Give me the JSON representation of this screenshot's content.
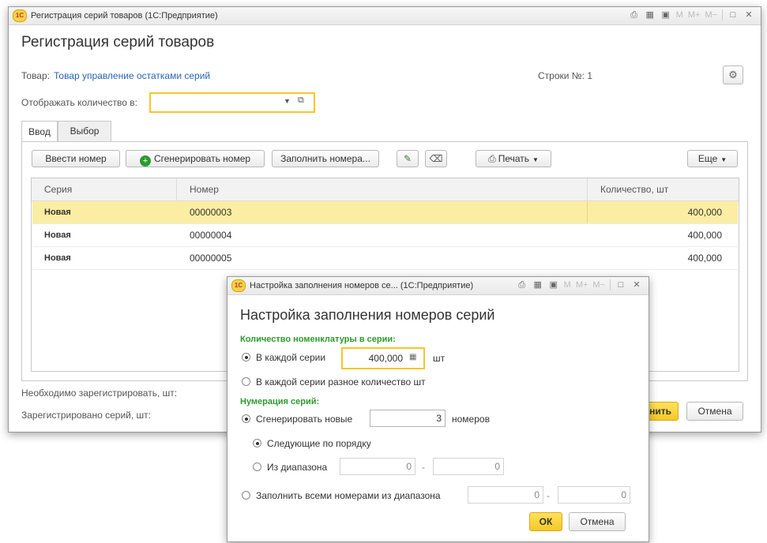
{
  "main": {
    "window_title": "Регистрация серий товаров  (1С:Предприятие)",
    "title": "Регистрация серий товаров",
    "product_label": "Товар:",
    "product_link": "Товар управление остатками серий",
    "rows_label": "Строки №: 1",
    "display_label": "Отображать количество в:",
    "display_value": "",
    "tabs": [
      "Ввод",
      "Выбор"
    ],
    "toolbar": {
      "enter_number": "Ввести номер",
      "generate_number": "Сгенерировать номер",
      "fill_numbers": "Заполнить номера...",
      "print": "Печать",
      "more": "Еще"
    },
    "table": {
      "columns": [
        "Серия",
        "Номер",
        "Количество, шт"
      ],
      "rows": [
        {
          "series": "Новая",
          "number": "00000003",
          "qty": "400,000"
        },
        {
          "series": "Новая",
          "number": "00000004",
          "qty": "400,000"
        },
        {
          "series": "Новая",
          "number": "00000005",
          "qty": "400,000"
        }
      ]
    },
    "need_register_label": "Необходимо зарегистрировать, шт:",
    "registered_label": "Зарегистрировано серий, шт:",
    "register_button": "нить",
    "cancel_button": "Отмена"
  },
  "dialog": {
    "window_title": "Настройка заполнения номеров се...  (1С:Предприятие)",
    "title": "Настройка заполнения номеров серий",
    "qty_section": "Количество номенклатуры в серии:",
    "each_series_label": "В каждой серии",
    "each_series_value": "400,000",
    "unit": "шт",
    "different_qty_label": "В каждой серии разное количество шт",
    "numbering_section": "Нумерация серий:",
    "generate_new_label": "Сгенерировать новые",
    "generate_new_value": "3",
    "numbers_label": "номеров",
    "sequential_label": "Следующие по порядку",
    "from_range_label": "Из диапазона",
    "range_from": "0",
    "range_to": "0",
    "dash": "-",
    "fill_all_label": "Заполнить всеми номерами из диапазона",
    "fill_from": "0",
    "fill_to": "0",
    "ok_button": "ОК",
    "cancel_button": "Отмена"
  },
  "titlebar_icons": {
    "m": "M",
    "mplus": "M+",
    "mminus": "M−",
    "restore": "□",
    "close": "✕"
  },
  "colors": {
    "accent_yellow": "#f8c52d",
    "selected_row": "#fbeea2",
    "section_green": "#2e9a2e",
    "link_blue": "#2a66b8"
  }
}
